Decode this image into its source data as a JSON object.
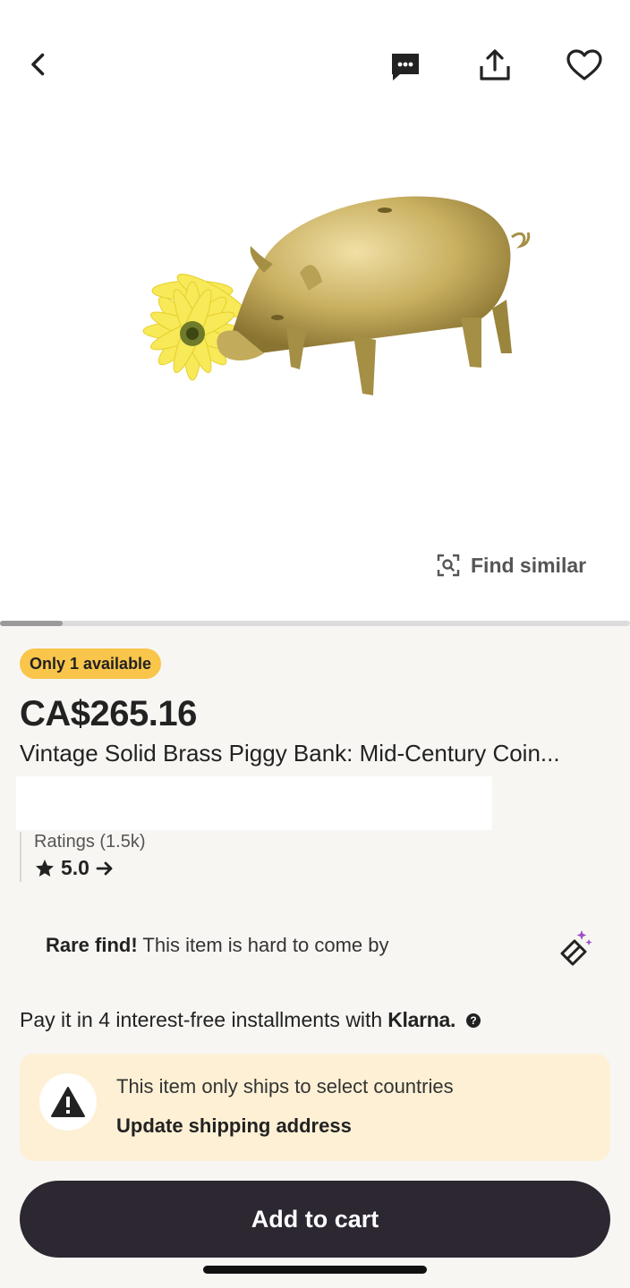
{
  "product": {
    "stock_badge": "Only 1 available",
    "price": "CA$265.16",
    "title": "Vintage Solid Brass Piggy Bank: Mid-Century Coin..."
  },
  "image_overlay": {
    "find_similar_label": "Find similar"
  },
  "ratings": {
    "label": "Ratings (1.5k)",
    "value": "5.0"
  },
  "rare_find": {
    "bold": "Rare find!",
    "text": "This item is hard to come by"
  },
  "klarna": {
    "text": "Pay it in 4 interest-free installments with",
    "brand": "Klarna."
  },
  "shipping": {
    "notice": "This item only ships to select countries",
    "link": "Update shipping address"
  },
  "actions": {
    "add_to_cart": "Add to cart"
  },
  "gallery": {
    "progress_fraction": 0.1
  },
  "colors": {
    "badge": "#f9c54a",
    "button": "#2c2731",
    "ship_card": "#fdf0d5"
  }
}
